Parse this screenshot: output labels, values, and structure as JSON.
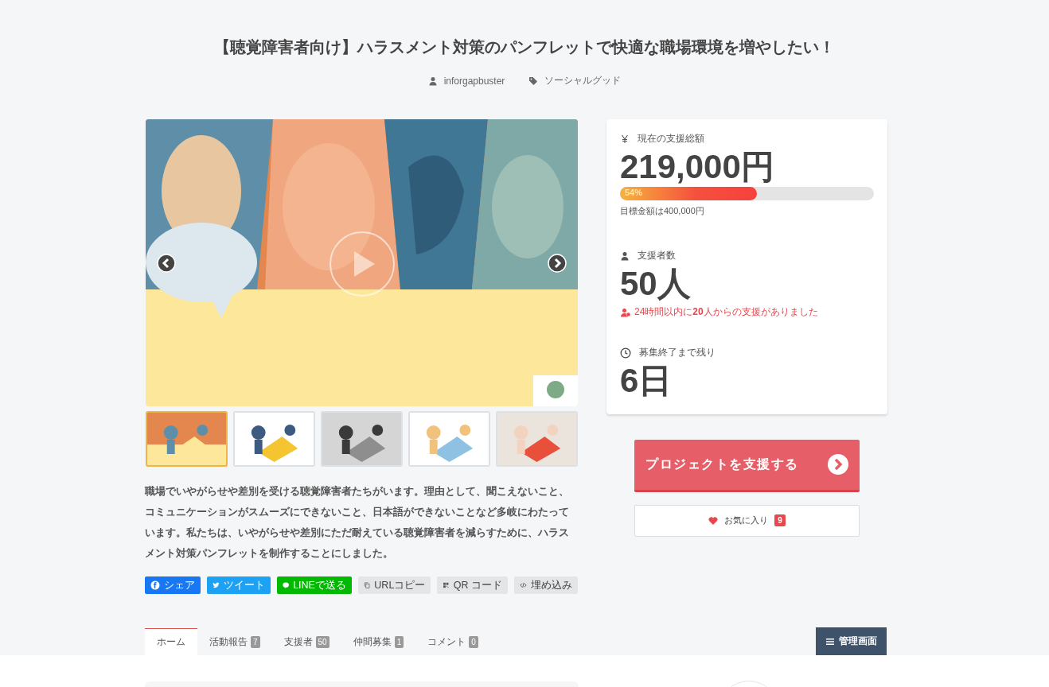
{
  "title": "【聴覚障害者向け】ハラスメント対策のパンフレットで快適な職場環境を増やしたい！",
  "meta": {
    "author": "inforgapbuster",
    "category": "ソーシャルグッド"
  },
  "gallery": {
    "main": {
      "kind": "picture"
    },
    "thumbnails": [
      {
        "kind": "picture",
        "selected": true
      },
      {
        "kind": "picture",
        "selected": false
      },
      {
        "kind": "picture",
        "selected": false
      },
      {
        "kind": "picture",
        "selected": false
      },
      {
        "kind": "picture",
        "selected": false
      }
    ]
  },
  "description": "職場でいやがらせや差別を受ける聴覚障害者たちがいます。理由として、聞こえないこと、コミュニケーションがスムーズにできないこと、日本語ができないことなど多岐にわたっています。私たちは、いやがらせや差別にただ耐えている聴覚障害者を減らすために、ハラスメント対策パンフレットを制作することにしました。",
  "share_buttons": [
    {
      "kind": "facebook",
      "label": "シェア"
    },
    {
      "kind": "twitter",
      "label": "ツイート"
    },
    {
      "kind": "line",
      "label": "LINEで送る"
    },
    {
      "kind": "url",
      "label": "URLコピー"
    },
    {
      "kind": "qr",
      "label": "QR コード"
    },
    {
      "kind": "embed",
      "label": "埋め込み"
    }
  ],
  "stats": {
    "amount": {
      "label": "現在の支援総額",
      "value": "219,000円",
      "level": 0.54,
      "percent": "54%",
      "goal": "目標金額は400,000円"
    },
    "backers": {
      "label": "支援者数",
      "value": "50人",
      "recent": "24時間以内に**20**人からの支援がありました"
    },
    "remaining": {
      "label": "募集終了まで残り",
      "value": "6日"
    }
  },
  "support_button": "プロジェクトを支援する",
  "favorite": {
    "label": "お気に入り",
    "count": "9"
  },
  "tabs": [
    {
      "label": "ホーム",
      "selected": true
    },
    {
      "label": "活動報告",
      "count": "7",
      "selected": false
    },
    {
      "label": "支援者",
      "count": "50",
      "selected": false
    },
    {
      "label": "仲間募集",
      "count": "1",
      "selected": false
    },
    {
      "label": "コメント",
      "count": "0",
      "selected": false
    }
  ],
  "admin_button": "管理画面"
}
